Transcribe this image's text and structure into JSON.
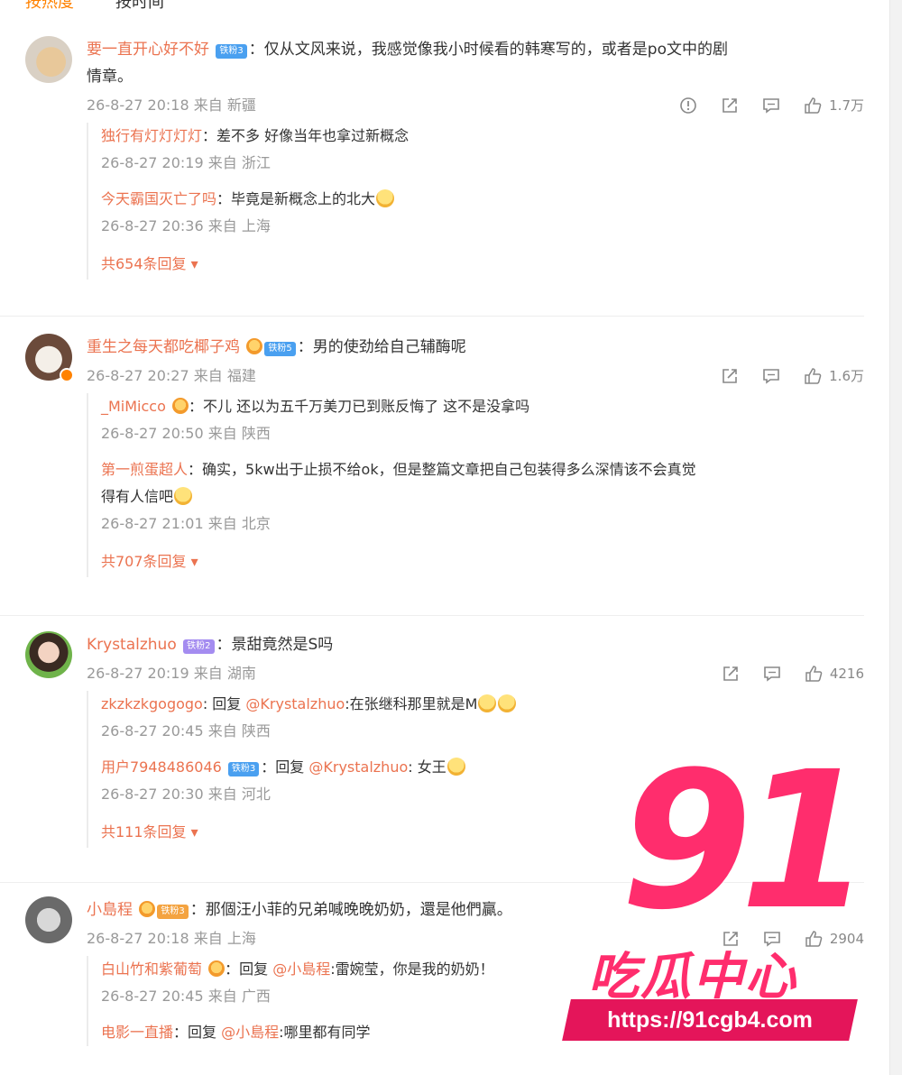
{
  "sort_tabs": {
    "hot": "按热度",
    "time": "按时间"
  },
  "comments": [
    {
      "user": "要一直开心好不好",
      "badge": "铁粉3",
      "text_line1": "：仅从文风来说，我感觉像我小时候看的韩寒写的，或者是po文中的剧",
      "text_line2": "情章。",
      "meta": "26-8-27 20:18 来自 新疆",
      "likes": "1.7万",
      "replies": [
        {
          "user": "独行有灯灯灯灯",
          "text": "：差不多 好像当年也拿过新概念",
          "meta": "26-8-27 20:19 来自 浙江"
        },
        {
          "user": "今天霸国灭亡了吗",
          "text": "：毕竟是新概念上的北大",
          "meta": "26-8-27 20:36 来自 上海"
        }
      ],
      "more": "共654条回复"
    },
    {
      "user": "重生之每天都吃椰子鸡",
      "badge": "铁粉5",
      "text_line1": "：男的使劲给自己辅酶呢",
      "meta": "26-8-27 20:27 来自 福建",
      "likes": "1.6万",
      "replies": [
        {
          "user": "_MiMicco",
          "text": "：不儿 还以为五千万美刀已到账反悔了 这不是没拿吗",
          "meta": "26-8-27 20:50 来自 陕西"
        },
        {
          "user": "第一煎蛋超人",
          "text_line1": "：确实，5kw出于止损不给ok，但是整篇文章把自己包装得多么深情该不会真觉",
          "text_line2": "得有人信吧",
          "meta": "26-8-27 21:01 来自 北京"
        }
      ],
      "more": "共707条回复"
    },
    {
      "user": "Krystalzhuo",
      "badge": "铁粉2",
      "text_line1": "：景甜竟然是S吗",
      "meta": "26-8-27 20:19 来自 湖南",
      "likes": "4216",
      "replies": [
        {
          "user": "zkzkzkgogogo",
          "prefix": ": 回复 ",
          "mention": "@Krystalzhuo",
          "text": ":在张继科那里就是M",
          "meta": "26-8-27 20:45 来自 陕西"
        },
        {
          "user": "用户7948486046",
          "badge": "铁粉3",
          "prefix": "：回复 ",
          "mention": "@Krystalzhuo",
          "text": ": 女王",
          "meta": "26-8-27 20:30 来自 河北"
        }
      ],
      "more": "共111条回复"
    },
    {
      "user": "小島程",
      "badge": "铁粉3",
      "text_line1": "：那個汪小菲的兄弟喊晚晚奶奶，還是他們贏。",
      "meta": "26-8-27 20:18 来自 上海",
      "likes": "2904",
      "replies": [
        {
          "user": "白山竹和紫葡萄",
          "prefix": "：回复 ",
          "mention": "@小島程",
          "text": ":雷婉莹，你是我的奶奶！",
          "meta": "26-8-27 20:45 来自 广西"
        },
        {
          "user": "电影一直播",
          "prefix": "：回复 ",
          "mention": "@小島程",
          "text": ":哪里都有同学"
        }
      ]
    }
  ],
  "watermark": {
    "number": "91",
    "title": "吃瓜中心",
    "url": "https://91cgb4.com"
  },
  "colors": {
    "username": "#eb7350",
    "accent": "#ff8200",
    "meta": "#999999",
    "watermark": "#ff2d6d"
  }
}
